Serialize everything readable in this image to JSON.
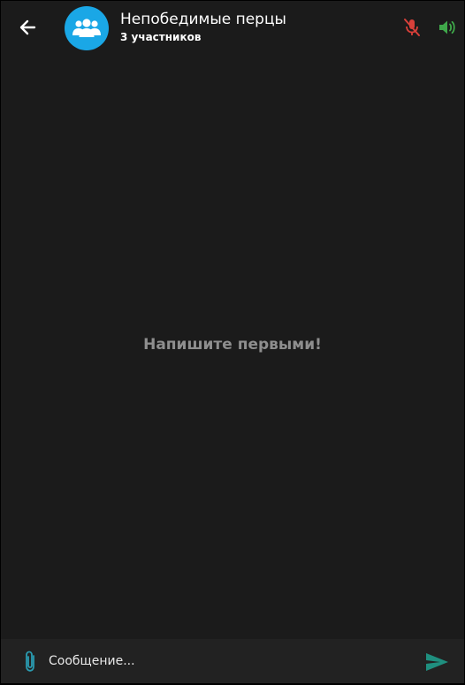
{
  "header": {
    "back_icon": "arrow-left-icon",
    "avatar_icon": "group-icon",
    "avatar_color": "#1aa7e6",
    "title": "Непобедимые перцы",
    "subtitle": "3 участников",
    "mic_icon": "mic-off-icon",
    "mic_color": "#d9403a",
    "speaker_icon": "volume-up-icon",
    "speaker_color": "#3fa84a"
  },
  "main": {
    "empty_message": "Напишите первыми!"
  },
  "composer": {
    "attach_icon": "paperclip-icon",
    "attach_color": "#2a9bb0",
    "placeholder": "Сообщение...",
    "value": "",
    "send_icon": "send-icon",
    "send_color": "#1f8f7f"
  }
}
